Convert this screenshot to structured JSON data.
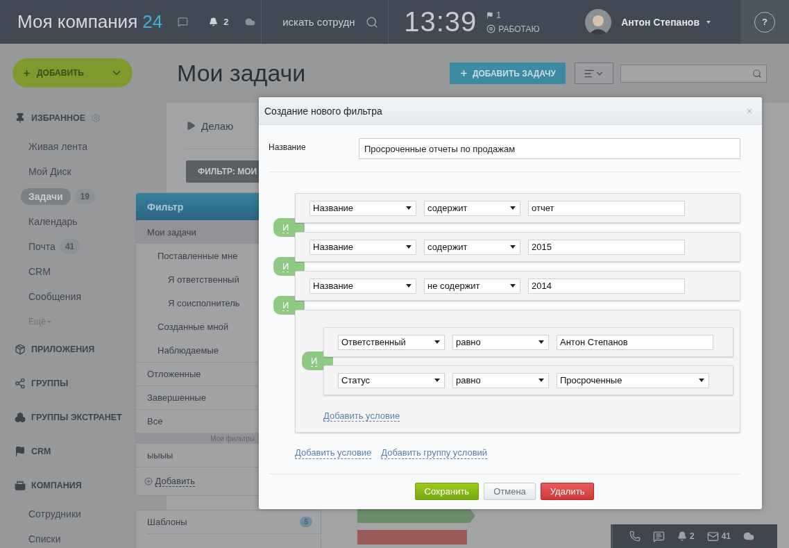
{
  "topbar": {
    "logo": "Моя компания",
    "logo_number": "24",
    "notifications": "2",
    "search": {
      "placeholder": "искать сотрудн"
    },
    "time": "13:39",
    "flag_count": "1",
    "status": "РАБОТАЮ",
    "user": "Антон Степанов",
    "help": "?"
  },
  "sidebar": {
    "add_button": "ДОБАВИТЬ",
    "sections": [
      {
        "title": "ИЗБРАННОЕ",
        "items": [
          {
            "label": "Живая лента",
            "kind": "link",
            "selected": false
          },
          {
            "label": "Мой Диск",
            "kind": "link",
            "selected": false
          },
          {
            "label": "Задачи",
            "badge": "19",
            "kind": "link",
            "selected": true
          },
          {
            "label": "Календарь",
            "kind": "link",
            "selected": false
          },
          {
            "label": "Почта",
            "badge": "41",
            "kind": "link",
            "selected": false
          },
          {
            "label": "CRM",
            "kind": "link",
            "selected": false
          },
          {
            "label": "Сообщения",
            "kind": "link",
            "selected": false
          },
          {
            "label": "Ещё",
            "kind": "more",
            "selected": false
          }
        ]
      },
      {
        "title": "ПРИЛОЖЕНИЯ"
      },
      {
        "title": "ГРУППЫ"
      },
      {
        "title": "ГРУППЫ ЭКСТРАНЕТ"
      },
      {
        "title": "CRM"
      },
      {
        "title": "КОМПАНИЯ",
        "items": [
          {
            "label": "Сотрудники",
            "kind": "link",
            "selected": false
          },
          {
            "label": "Списки",
            "kind": "link",
            "selected": false
          }
        ]
      }
    ]
  },
  "page": {
    "title": "Мои задачи",
    "add_task_button": "ДОБАВИТЬ ЗАДАЧУ",
    "tab": "Делаю",
    "filter_button": "ФИЛЬТР: МОИ"
  },
  "filter_menu": {
    "title": "Фильтр",
    "items": [
      {
        "label": "Мои задачи",
        "selected": true,
        "children": [
          {
            "label": "Поставленные мне",
            "selected": false,
            "children": [
              {
                "label": "Я ответственный",
                "selected": false
              },
              {
                "label": "Я соисполнитель",
                "selected": false
              }
            ]
          },
          {
            "label": "Созданные мной",
            "selected": false
          },
          {
            "label": "Наблюдаемые",
            "selected": false
          }
        ]
      },
      {
        "label": "Отложенные",
        "selected": false
      },
      {
        "label": "Завершенные",
        "selected": false
      },
      {
        "label": "Все",
        "selected": false
      }
    ],
    "my_filters_heading": "Мои фильтры",
    "my_filters": [
      "ыыыы"
    ],
    "add_link": "Добавить"
  },
  "templates": {
    "label": "Шаблоны",
    "count": "5"
  },
  "dialog": {
    "title": "Создание нового фильтра",
    "name_label": "Название",
    "name_value": "Просроченные отчеты по продажам",
    "conditions": [
      {
        "kind": "condition",
        "field": "Название",
        "operator": "содержит",
        "value": {
          "kind": "text",
          "text": "отчет"
        }
      },
      {
        "kind": "condition",
        "connector": "И",
        "field": "Название",
        "operator": "содержит",
        "value": {
          "kind": "text",
          "text": "2015"
        }
      },
      {
        "kind": "condition",
        "connector": "И",
        "field": "Название",
        "operator": "не содержит",
        "value": {
          "kind": "text",
          "text": "2014"
        }
      },
      {
        "kind": "group",
        "connector": "И",
        "add_condition": "Добавить условие",
        "conditions": [
          {
            "kind": "condition",
            "field": "Ответственный",
            "operator": "равно",
            "value": {
              "kind": "text",
              "text": "Антон Степанов"
            }
          },
          {
            "kind": "condition",
            "connector": "И",
            "field": "Статус",
            "operator": "равно",
            "value": {
              "kind": "select",
              "text": "Просроченные"
            }
          }
        ]
      }
    ],
    "add_condition": "Добавить условие",
    "add_group": "Добавить группу условий",
    "buttons": [
      {
        "label": "Сохранить",
        "kind": "save"
      },
      {
        "label": "Отмена",
        "kind": "cancel"
      },
      {
        "label": "Удалить",
        "kind": "delete"
      }
    ]
  },
  "bottom_bar": {
    "notifications": "2",
    "messages": "41"
  }
}
